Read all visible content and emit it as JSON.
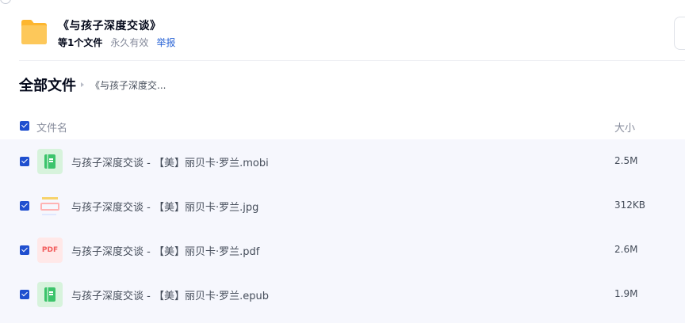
{
  "share": {
    "title": "《与孩子深度交谈》",
    "file_count": "等1个文件",
    "validity": "永久有效",
    "report_label": "举报"
  },
  "breadcrumb": {
    "root": "全部文件",
    "current": "《与孩子深度交..."
  },
  "list": {
    "header_name": "文件名",
    "header_size": "大小",
    "files": [
      {
        "name": "与孩子深度交谈 - 【美】丽贝卡·罗兰.mobi",
        "size": "2.5M",
        "icon": "ebook-icon",
        "checked": true
      },
      {
        "name": "与孩子深度交谈 - 【美】丽贝卡·罗兰.jpg",
        "size": "312KB",
        "icon": "image-thumbnail",
        "checked": true
      },
      {
        "name": "与孩子深度交谈 - 【美】丽贝卡·罗兰.pdf",
        "size": "2.6M",
        "icon": "pdf-icon",
        "checked": true
      },
      {
        "name": "与孩子深度交谈 - 【美】丽贝卡·罗兰.epub",
        "size": "1.9M",
        "icon": "ebook-icon",
        "checked": true
      }
    ]
  },
  "icons": {
    "pdf_text": "PDF"
  },
  "colors": {
    "accent_blue": "#1f4fcf",
    "link_blue": "#2a64d6",
    "list_bg": "#f6f7fd",
    "folder_yellow": "#fdc14c"
  }
}
